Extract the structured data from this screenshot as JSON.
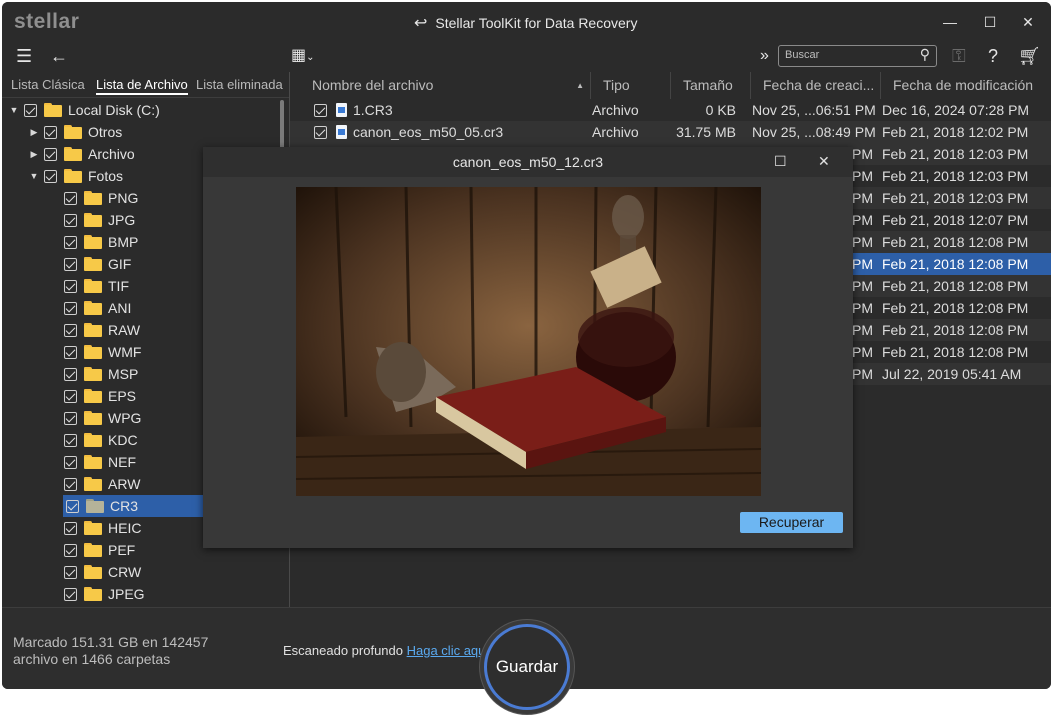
{
  "app": {
    "logo": "stellar",
    "title": "Stellar ToolKit for Data Recovery"
  },
  "toolbar": {
    "search_placeholder": "Buscar"
  },
  "tabs": [
    "Lista Clásica",
    "Lista de Archivo",
    "Lista eliminada"
  ],
  "tree": {
    "root": "Local Disk (C:)",
    "level1": [
      "Otros",
      "Archivo",
      "Fotos"
    ],
    "fotos_children": [
      "PNG",
      "JPG",
      "BMP",
      "GIF",
      "TIF",
      "ANI",
      "RAW",
      "WMF",
      "MSP",
      "EPS",
      "WPG",
      "KDC",
      "NEF",
      "ARW",
      "CR3",
      "HEIC",
      "PEF",
      "CRW",
      "JPEG"
    ],
    "selected": "CR3"
  },
  "columns": [
    "Nombre del archivo",
    "Tipo",
    "Tamaño",
    "Fecha de creaci...",
    "Fecha de modificación"
  ],
  "files": [
    {
      "name": "1.CR3",
      "type": "Archivo",
      "size": "0  KB",
      "created": "Nov 25, ...06:51 PM",
      "modified": "Dec 16, 2024 07:28 PM"
    },
    {
      "name": "canon_eos_m50_05.cr3",
      "type": "Archivo",
      "size": "31.75 MB",
      "created": "Nov 25, ...08:49 PM",
      "modified": "Feb 21, 2018 12:02 PM"
    }
  ],
  "hidden_rows": [
    {
      "created_tail": "PM",
      "modified": "Feb 21, 2018 12:03 PM"
    },
    {
      "created_tail": "PM",
      "modified": "Feb 21, 2018 12:03 PM"
    },
    {
      "created_tail": "PM",
      "modified": "Feb 21, 2018 12:03 PM"
    },
    {
      "created_tail": "PM",
      "modified": "Feb 21, 2018 12:07 PM"
    },
    {
      "created_tail": "PM",
      "modified": "Feb 21, 2018 12:08 PM"
    },
    {
      "created_tail": "PM",
      "modified": "Feb 21, 2018 12:08 PM"
    },
    {
      "created_tail": "PM",
      "modified": "Feb 21, 2018 12:08 PM"
    },
    {
      "created_tail": "PM",
      "modified": "Feb 21, 2018 12:08 PM"
    },
    {
      "created_tail": "PM",
      "modified": "Feb 21, 2018 12:08 PM"
    },
    {
      "created_tail": "PM",
      "modified": "Feb 21, 2018 12:08 PM"
    },
    {
      "created_tail": "PM",
      "modified": "Jul 22, 2019 05:41 AM"
    }
  ],
  "selected_hidden_row": 5,
  "modal": {
    "title": "canon_eos_m50_12.cr3",
    "recover_label": "Recuperar"
  },
  "bottom": {
    "status_line1": "Marcado 151.31 GB en 142457",
    "status_line2": "archivo en 1466 carpetas",
    "deep_scan_label": "Escaneado profundo",
    "deep_scan_link": "Haga clic aquí",
    "save_label": "Guardar"
  },
  "colors": {
    "background": "#2b2b2b",
    "selection": "#2d5fa8",
    "accent_button": "#6db6f2",
    "link": "#5aa9ef",
    "folder": "#f7c948"
  },
  "icons": [
    "menu-icon",
    "back-arrow-icon",
    "view-grid-icon",
    "expand-icon",
    "search-icon",
    "key-icon",
    "help-icon",
    "cart-icon"
  ]
}
